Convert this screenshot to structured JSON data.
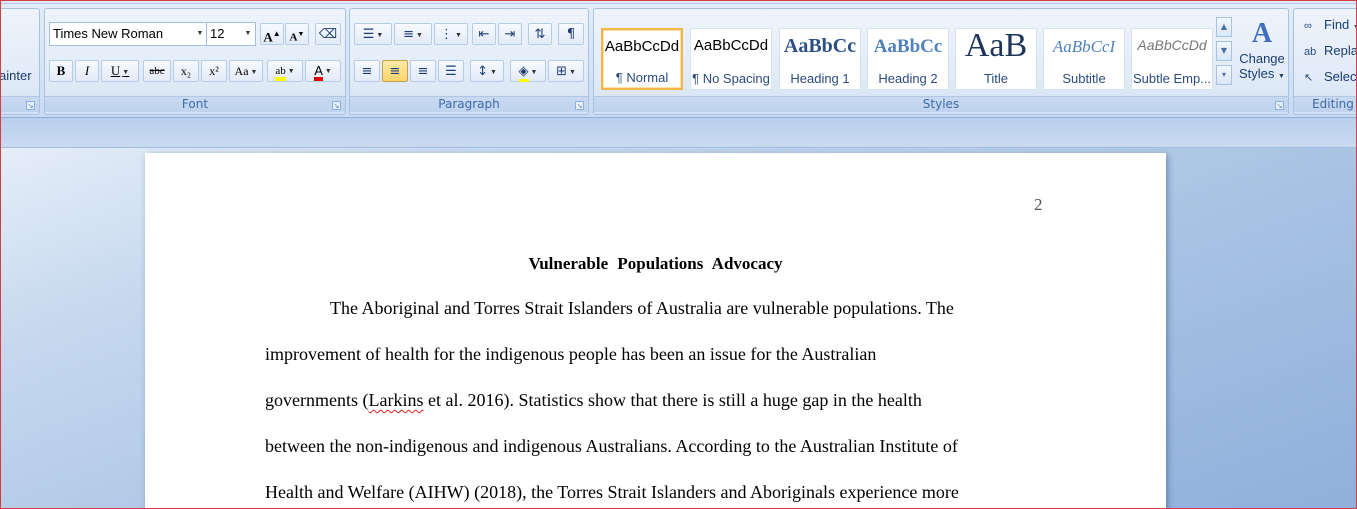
{
  "clipboard": {
    "painter_label": "ainter"
  },
  "font": {
    "label": "Font",
    "family": "Times New Roman",
    "size": "12",
    "grow_label": "A",
    "shrink_label": "A",
    "bold_label": "B",
    "italic_label": "I",
    "underline_label": "U",
    "strike_label": "abc",
    "subscript_label": "x₂",
    "superscript_label": "x²",
    "case_label": "Aa",
    "highlight_label": "ab",
    "color_label": "A",
    "highlight_color": "#ffff00",
    "font_color": "#e00000"
  },
  "paragraph": {
    "label": "Paragraph",
    "pilcrow": "¶"
  },
  "styles": {
    "label": "Styles",
    "items": [
      {
        "sample": "AaBbCcDd",
        "name": "¶ Normal"
      },
      {
        "sample": "AaBbCcDd",
        "name": "¶ No Spacing"
      },
      {
        "sample": "AaBbCc",
        "name": "Heading 1"
      },
      {
        "sample": "AaBbCc",
        "name": "Heading 2"
      },
      {
        "sample": "AaB",
        "name": "Title"
      },
      {
        "sample": "AaBbCcI",
        "name": "Subtitle"
      },
      {
        "sample": "AaBbCcDd",
        "name": "Subtle Emp..."
      }
    ],
    "change_line1": "Change",
    "change_line2": "Styles"
  },
  "editing": {
    "label": "Editing",
    "find": "Find",
    "replace": "Repla",
    "select": "Select"
  },
  "document": {
    "page_number": "2",
    "title": "Vulnerable Populations Advocacy",
    "lines": [
      "The Aboriginal and Torres Strait Islanders of Australia are vulnerable populations. The",
      "improvement of health for the indigenous people has been an issue for the Australian",
      "between the non-indigenous and indigenous Australians. According to the Australian Institute of",
      "Health and Welfare (AIHW) (2018), the Torres Strait Islanders and Aboriginals experience more"
    ],
    "line3_pre": "governments (",
    "line3_misspelled": "Larkins",
    "line3_post": " et al. 2016). Statistics show that there is still a huge gap in the health"
  }
}
